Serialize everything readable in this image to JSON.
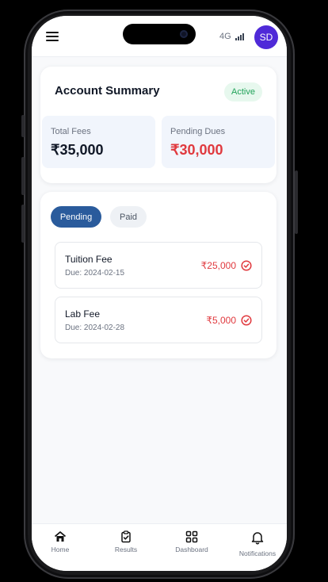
{
  "header": {
    "network": "4G",
    "avatar_initials": "SD"
  },
  "summary": {
    "title": "Account Summary",
    "status": "Active",
    "total_fees_label": "Total Fees",
    "total_fees_value": "₹35,000",
    "pending_dues_label": "Pending Dues",
    "pending_dues_value": "₹30,000"
  },
  "tabs": {
    "pending": "Pending",
    "paid": "Paid"
  },
  "fees": [
    {
      "name": "Tuition Fee",
      "due": "Due: 2024-02-15",
      "amount": "₹25,000"
    },
    {
      "name": "Lab Fee",
      "due": "Due: 2024-02-28",
      "amount": "₹5,000"
    }
  ],
  "nav": {
    "home": "Home",
    "results": "Results",
    "dashboard": "Dashboard",
    "notifications": "Notifications"
  },
  "colors": {
    "accent": "#2a5b9c",
    "avatar": "#4f2ad8",
    "danger": "#e0393e",
    "success": "#22a35a"
  },
  "icons": [
    "menu-icon",
    "signal-icon",
    "check-circle-icon",
    "home-icon",
    "clipboard-check-icon",
    "grid-icon",
    "bell-icon"
  ]
}
